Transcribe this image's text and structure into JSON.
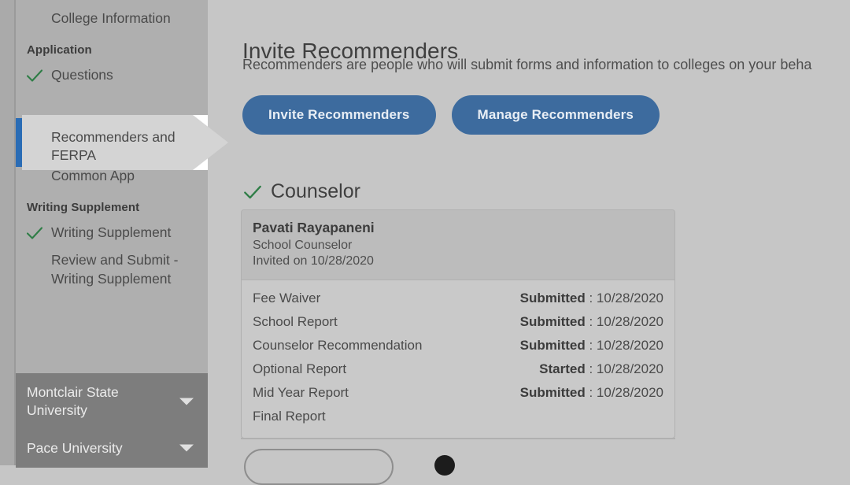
{
  "sidebar": {
    "items": [
      {
        "label": "College Information",
        "checked": false,
        "type": "item"
      },
      {
        "label": "Application",
        "type": "section"
      },
      {
        "label": "Questions",
        "checked": true,
        "type": "item"
      },
      {
        "label": "Recommenders and FERPA",
        "checked": false,
        "type": "active-item"
      },
      {
        "label": "Review and Submit - Common App",
        "checked": false,
        "type": "item"
      },
      {
        "label": "Writing Supplement",
        "type": "section"
      },
      {
        "label": "Writing Supplement",
        "checked": true,
        "type": "item"
      },
      {
        "label": "Review and Submit - Writing Supplement",
        "checked": false,
        "type": "item"
      }
    ],
    "active_item_label": "Recommenders and FERPA",
    "universities": [
      {
        "name": "Montclair State University",
        "chevron": "chevron-down-icon"
      },
      {
        "name": "Pace University",
        "chevron": "chevron-down-icon"
      }
    ]
  },
  "main": {
    "title": "Invite Recommenders",
    "description": "Recommenders are people who will submit forms and information to colleges on your beha",
    "buttons": {
      "invite": "Invite Recommenders",
      "manage": "Manage Recommenders"
    },
    "section": {
      "title": "Counselor",
      "checked": true
    },
    "recommender": {
      "name": "Pavati Rayapaneni",
      "role": "School Counselor",
      "invited": "Invited on 10/28/2020",
      "forms": [
        {
          "name": "Fee Waiver",
          "status": "Submitted",
          "date": "10/28/2020"
        },
        {
          "name": "School Report",
          "status": "Submitted",
          "date": "10/28/2020"
        },
        {
          "name": "Counselor Recommendation",
          "status": "Submitted",
          "date": "10/28/2020"
        },
        {
          "name": "Optional Report",
          "status": "Started",
          "date": "10/28/2020"
        },
        {
          "name": "Mid Year Report",
          "status": "Submitted",
          "date": "10/28/2020"
        },
        {
          "name": "Final Report",
          "status": "",
          "date": ""
        }
      ]
    }
  },
  "colors": {
    "accent_blue": "#2a6cb5",
    "button_blue": "#3d6b9e",
    "check_green": "#2e7d46",
    "sidebar_bg": "#afafaf",
    "content_bg": "#c6c6c6",
    "dropdown_bg": "#7d7d7d"
  }
}
